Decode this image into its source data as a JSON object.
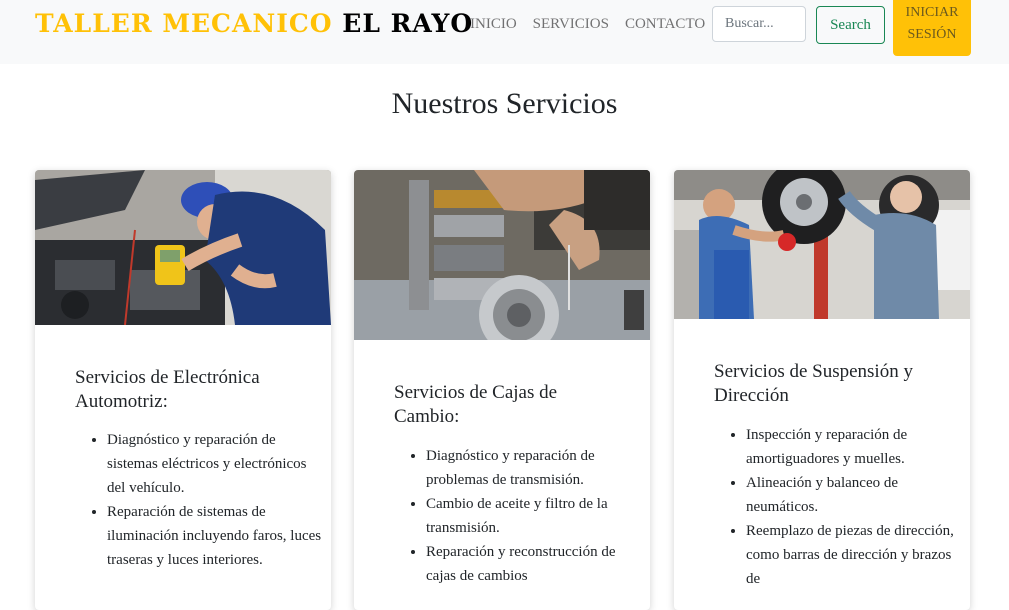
{
  "navbar": {
    "brand_part1": "TALLER MECANICO",
    "brand_part2": "EL RAYO",
    "links": [
      "INICIO",
      "SERVICIOS",
      "CONTACTO"
    ],
    "search_placeholder": "Buscar...",
    "search_button": "Search",
    "login_line1": "INICIAR",
    "login_line2": "SESIÓN"
  },
  "page_title": "Nuestros Servicios",
  "cards": [
    {
      "title": "Servicios de Electrónica Automotriz:",
      "image": "mechanic-diagnosing-engine-electronics-photo",
      "items": [
        "Diagnóstico y reparación de sistemas eléctricos y electrónicos del vehículo.",
        "Reparación de sistemas de iluminación incluyendo faros, luces traseras y luces interiores."
      ]
    },
    {
      "title": "Servicios de Cajas de Cambio:",
      "image": "gearbox-repair-photo",
      "items": [
        "Diagnóstico y reparación de problemas de transmisión.",
        "Cambio de aceite y filtro de la transmisión.",
        "Reparación y reconstrucción de cajas de cambios"
      ]
    },
    {
      "title": "Servicios de Suspensión y Dirección",
      "image": "mechanics-inspecting-wheel-suspension-photo",
      "items": [
        "Inspección y reparación de amortiguadores y muelles.",
        "Alineación y balanceo de neumáticos.",
        "Reemplazo de piezas de dirección, como barras de dirección y brazos de"
      ]
    }
  ],
  "colors": {
    "brand_accent": "#ffc107",
    "search_green": "#198754",
    "navbar_bg": "#f8f9fa"
  }
}
